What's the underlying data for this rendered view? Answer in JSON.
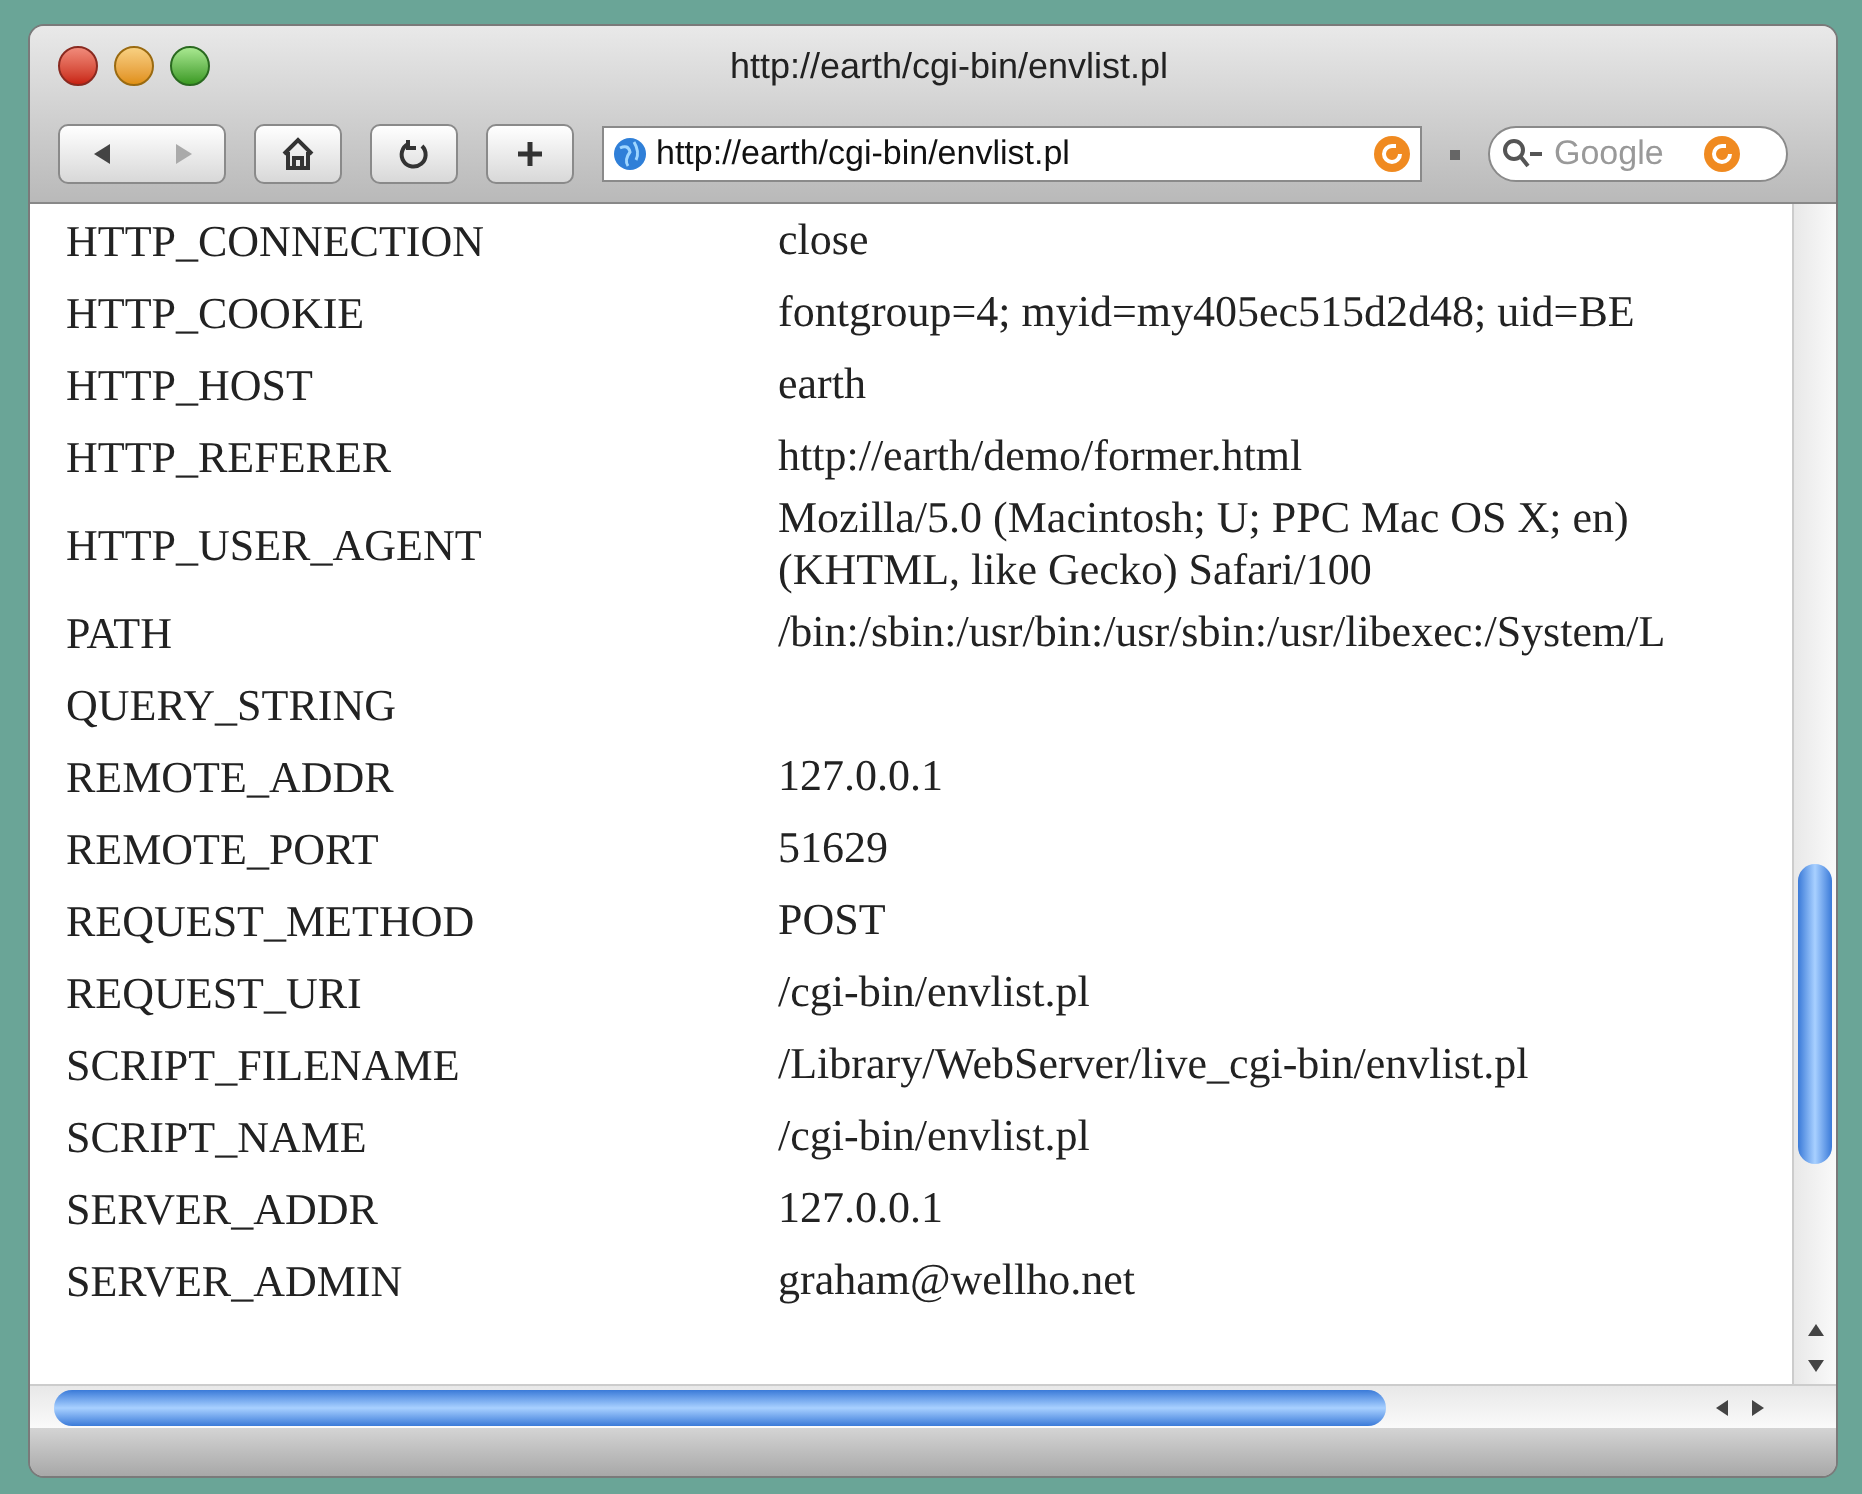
{
  "window": {
    "title": "http://earth/cgi-bin/envlist.pl"
  },
  "toolbar": {
    "address": "http://earth/cgi-bin/envlist.pl",
    "search": {
      "placeholder": "Google"
    }
  },
  "rows": [
    {
      "name": "HTTP_CONNECTION",
      "value": [
        "close"
      ]
    },
    {
      "name": "HTTP_COOKIE",
      "value": [
        "fontgroup=4; myid=my405ec515d2d48; uid=BE"
      ]
    },
    {
      "name": "HTTP_HOST",
      "value": [
        "earth"
      ]
    },
    {
      "name": "HTTP_REFERER",
      "value": [
        "http://earth/demo/former.html"
      ]
    },
    {
      "name": "HTTP_USER_AGENT",
      "value": [
        "Mozilla/5.0 (Macintosh; U; PPC Mac OS X; en)",
        "(KHTML, like Gecko) Safari/100"
      ]
    },
    {
      "name": "PATH",
      "value": [
        "/bin:/sbin:/usr/bin:/usr/sbin:/usr/libexec:/System/L"
      ]
    },
    {
      "name": "QUERY_STRING",
      "value": []
    },
    {
      "name": "REMOTE_ADDR",
      "value": [
        "127.0.0.1"
      ]
    },
    {
      "name": "REMOTE_PORT",
      "value": [
        "51629"
      ]
    },
    {
      "name": "REQUEST_METHOD",
      "value": [
        "POST"
      ]
    },
    {
      "name": "REQUEST_URI",
      "value": [
        "/cgi-bin/envlist.pl"
      ]
    },
    {
      "name": "SCRIPT_FILENAME",
      "value": [
        "/Library/WebServer/live_cgi-bin/envlist.pl"
      ]
    },
    {
      "name": "SCRIPT_NAME",
      "value": [
        "/cgi-bin/envlist.pl"
      ]
    },
    {
      "name": "SERVER_ADDR",
      "value": [
        "127.0.0.1"
      ]
    },
    {
      "name": "SERVER_ADMIN",
      "value": [
        "graham@wellho.net"
      ]
    }
  ]
}
